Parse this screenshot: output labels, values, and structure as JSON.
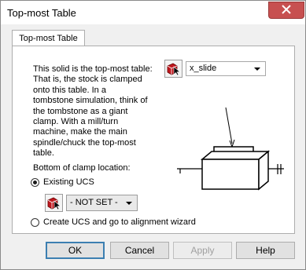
{
  "window": {
    "title": "Top-most Table"
  },
  "tab": {
    "label": "Top-most Table"
  },
  "description": {
    "lines": [
      "This solid is the top-most table:",
      "That is, the stock is clamped",
      "onto this table.  In a",
      "tombstone simulation, think of",
      "the tombstone as a giant",
      "clamp.  With a mill/turn",
      "machine, make the main",
      "spindle/chuck the top-most",
      "table."
    ]
  },
  "solid_selector": {
    "value": "x_slide"
  },
  "clamp": {
    "label": "Bottom of clamp location:",
    "existing_ucs_label": "Existing UCS",
    "existing_ucs_checked": true,
    "ucs_value": "- NOT SET -",
    "create_ucs_label": "Create UCS and go to alignment wizard",
    "create_ucs_checked": false
  },
  "buttons": {
    "ok": "OK",
    "cancel": "Cancel",
    "apply": "Apply",
    "help": "Help"
  },
  "icons": {
    "close": "close-icon",
    "pick": "pick-solid-icon",
    "diagram": "table-clamp-diagram"
  }
}
